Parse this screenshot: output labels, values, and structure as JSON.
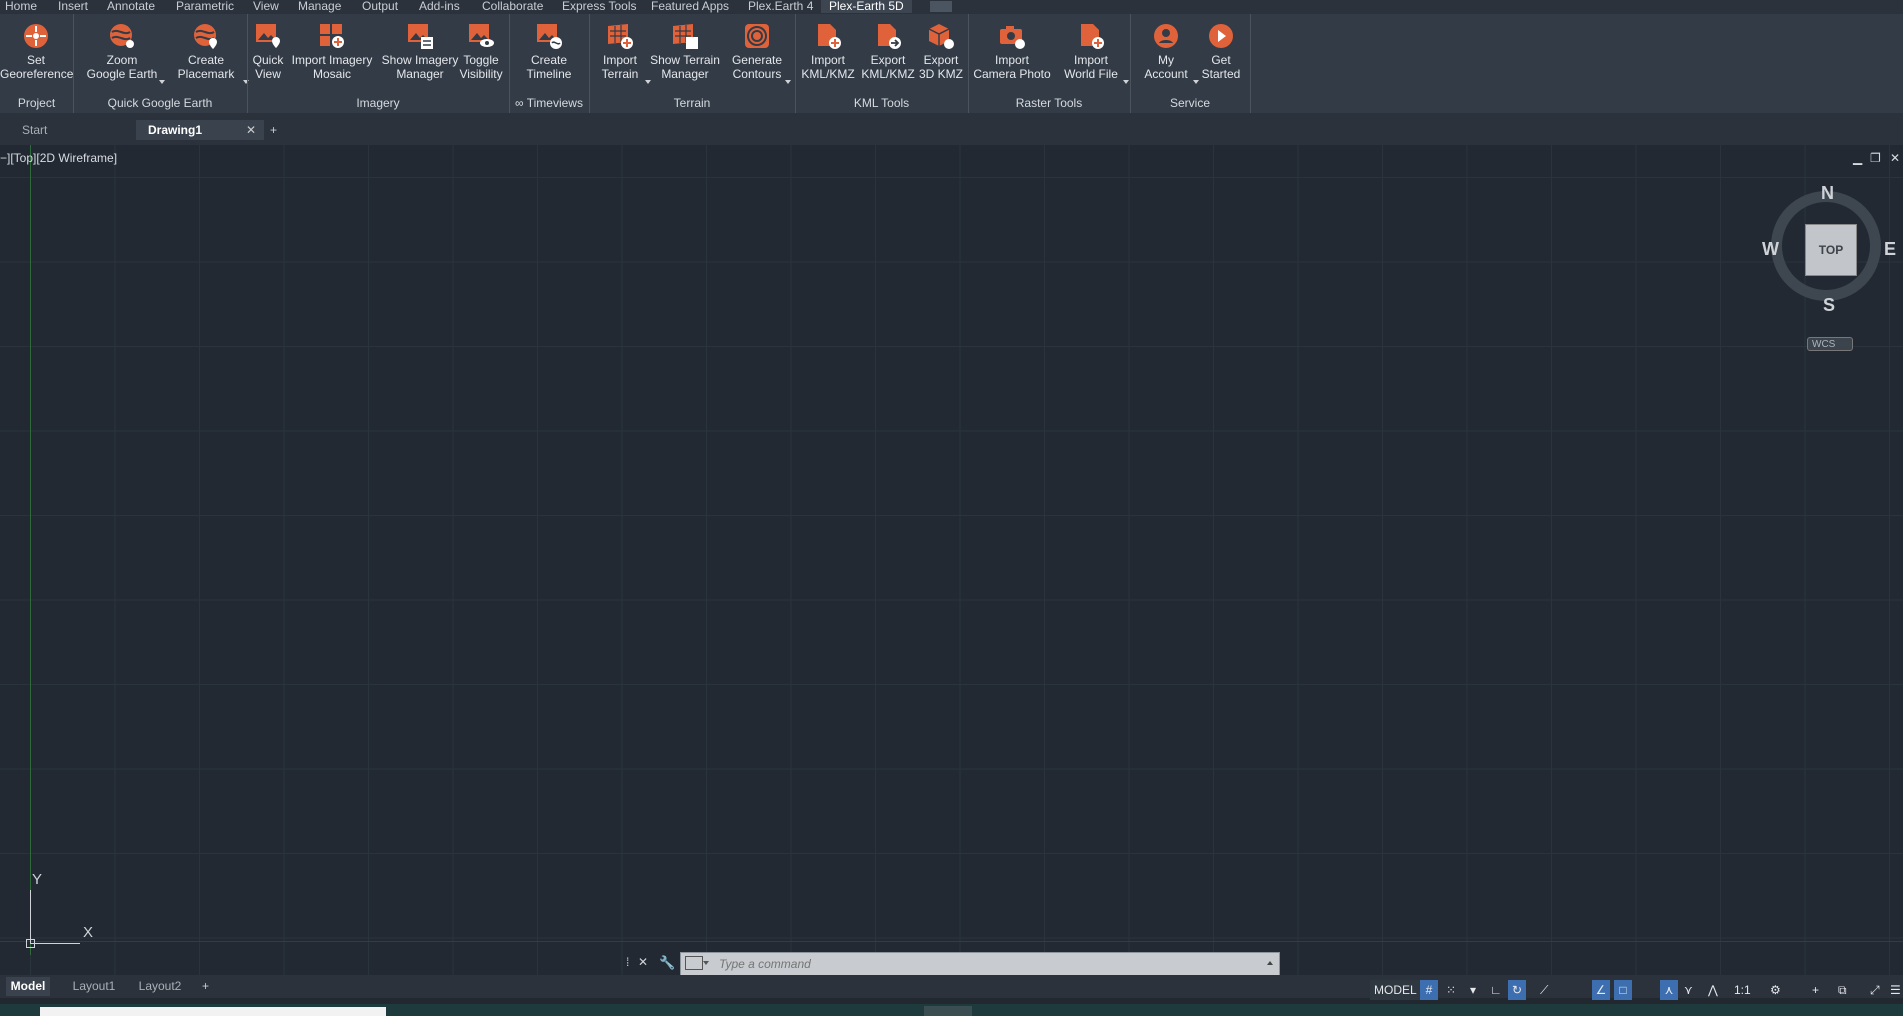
{
  "menu_tabs": [
    "Home",
    "Insert",
    "Annotate",
    "Parametric",
    "View",
    "Manage",
    "Output",
    "Add-ins",
    "Collaborate",
    "Express Tools",
    "Featured Apps",
    "Plex.Earth 4",
    "Plex-Earth 5D"
  ],
  "ribbon": {
    "buttons": [
      {
        "l1": "Set",
        "l2": "Georeference",
        "icon": "georeference-icon"
      },
      {
        "l1": "Zoom",
        "l2": "Google Earth",
        "icon": "google-earth-zoom-icon"
      },
      {
        "l1": "Create",
        "l2": "Placemark",
        "icon": "placemark-icon"
      },
      {
        "l1": "Quick",
        "l2": "View",
        "icon": "quick-view-icon"
      },
      {
        "l1": "Import Imagery",
        "l2": "Mosaic",
        "icon": "mosaic-icon"
      },
      {
        "l1": "Show Imagery",
        "l2": "Manager",
        "icon": "imagery-manager-icon"
      },
      {
        "l1": "Toggle",
        "l2": "Visibility",
        "icon": "visibility-icon"
      },
      {
        "l1": "Create",
        "l2": "Timeline",
        "icon": "timeline-icon"
      },
      {
        "l1": "Import",
        "l2": "Terrain",
        "icon": "import-terrain-icon"
      },
      {
        "l1": "Show Terrain",
        "l2": "Manager",
        "icon": "terrain-manager-icon"
      },
      {
        "l1": "Generate",
        "l2": "Contours",
        "icon": "contours-icon"
      },
      {
        "l1": "Import",
        "l2": "KML/KMZ",
        "icon": "import-kml-icon"
      },
      {
        "l1": "Export",
        "l2": "KML/KMZ",
        "icon": "export-kml-icon"
      },
      {
        "l1": "Export",
        "l2": "3D KMZ",
        "icon": "export-3d-kmz-icon"
      },
      {
        "l1": "Import",
        "l2": "Camera Photo",
        "icon": "camera-photo-icon"
      },
      {
        "l1": "Import",
        "l2": "World File",
        "icon": "world-file-icon"
      },
      {
        "l1": "My",
        "l2": "Account",
        "icon": "account-icon"
      },
      {
        "l1": "Get",
        "l2": "Started",
        "icon": "get-started-icon"
      }
    ],
    "panels": [
      "Project",
      "Quick Google Earth",
      "Imagery",
      "∞ Timeviews",
      "Terrain",
      "KML Tools",
      "Raster Tools",
      "Service"
    ]
  },
  "doc_tabs": {
    "start": "Start",
    "drawing": "Drawing1"
  },
  "viewport": {
    "label": "−][Top][2D Wireframe]"
  },
  "viewcube": {
    "n": "N",
    "s": "S",
    "e": "E",
    "w": "W",
    "top": "TOP",
    "wcs": "WCS"
  },
  "ucs": {
    "y": "Y",
    "x": "X"
  },
  "command": {
    "placeholder": "Type a command"
  },
  "layout_tabs": [
    "Model",
    "Layout1",
    "Layout2"
  ],
  "status": {
    "model": "MODEL",
    "scale": "1:1"
  },
  "colors": {
    "accent": "#e0623a",
    "bg": "#212830",
    "ribbon": "#333b46"
  }
}
